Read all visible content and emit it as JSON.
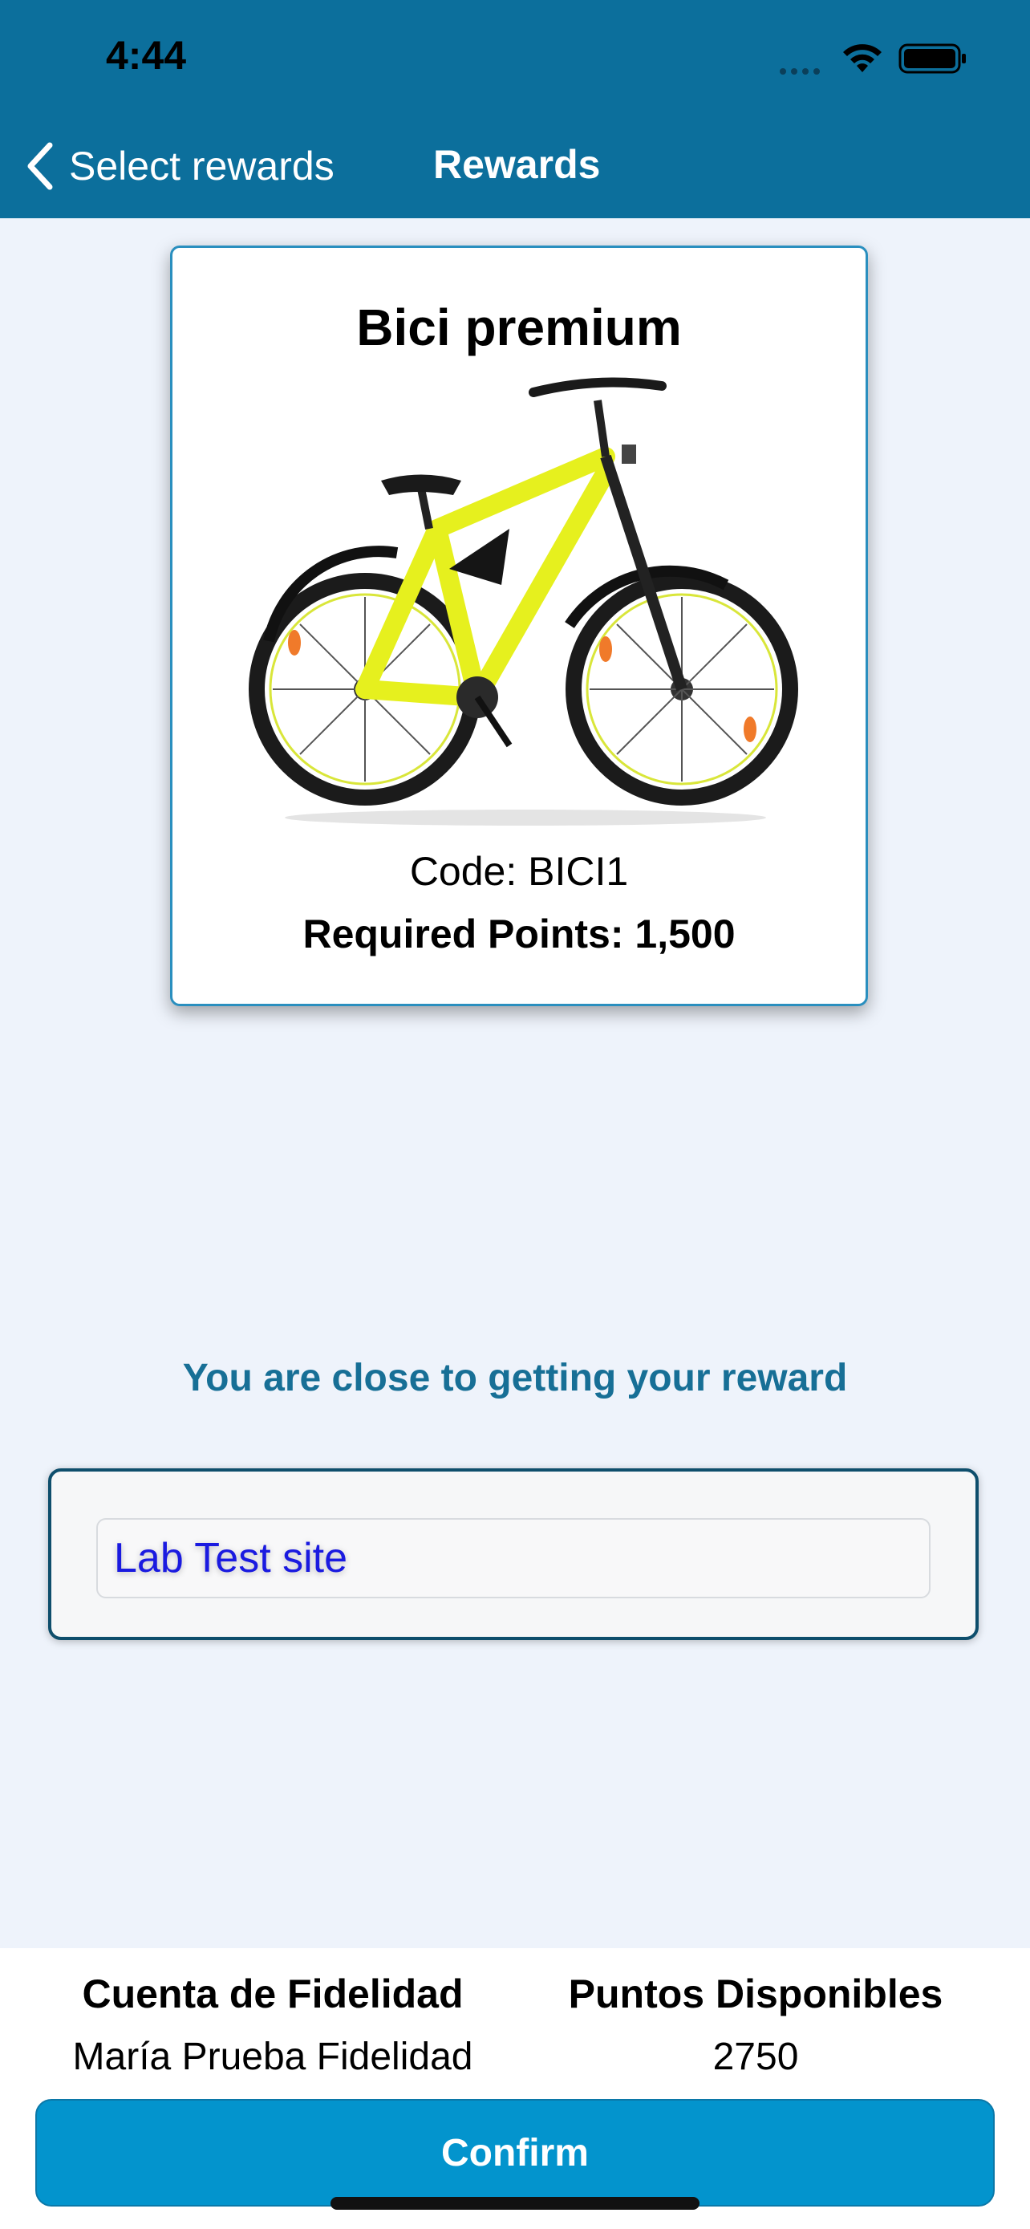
{
  "status_bar": {
    "time": "4:44"
  },
  "nav": {
    "back_label": "Select rewards",
    "title": "Rewards"
  },
  "reward": {
    "title": "Bici premium",
    "code_text": "Code: BICI1",
    "points_text": "Required Points: 1,500",
    "image_icon": "bicycle-image"
  },
  "message": "You are close to getting your reward",
  "site": {
    "value": "Lab Test site"
  },
  "account": {
    "label": "Cuenta de Fidelidad",
    "value": "María Prueba Fidelidad"
  },
  "points": {
    "label": "Puntos Disponibles",
    "value": "2750"
  },
  "confirm_label": "Confirm",
  "colors": {
    "header": "#0c6f9c",
    "accent": "#0394cd",
    "message": "#176f96",
    "link_text": "#1a1ae0"
  }
}
